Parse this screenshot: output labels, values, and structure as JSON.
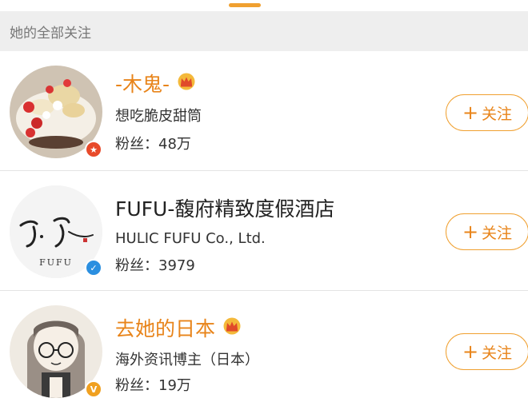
{
  "section_title": "她的全部关注",
  "follow_label": "关注",
  "users": [
    {
      "name": "-木鬼-",
      "description": "想吃脆皮甜筒",
      "fans_label": "粉丝：",
      "fans_count": "48万",
      "badge_icon": "star-badge-icon",
      "has_crown": true
    },
    {
      "name": "FUFU-馥府精致度假酒店",
      "description": "HULIC FUFU Co., Ltd.",
      "fans_label": "粉丝：",
      "fans_count": "3979",
      "badge_icon": "verified-blue-icon",
      "logo_text": "FUFU",
      "has_crown": false
    },
    {
      "name": "去她的日本",
      "description": "海外资讯博主（日本）",
      "fans_label": "粉丝：",
      "fans_count": "19万",
      "badge_icon": "verified-orange-icon",
      "has_crown": true
    }
  ],
  "colors": {
    "accent_orange": "#e8841a",
    "button_border": "#f0a030",
    "verified_blue": "#2b8fe0",
    "header_bg": "#eeeeee"
  }
}
